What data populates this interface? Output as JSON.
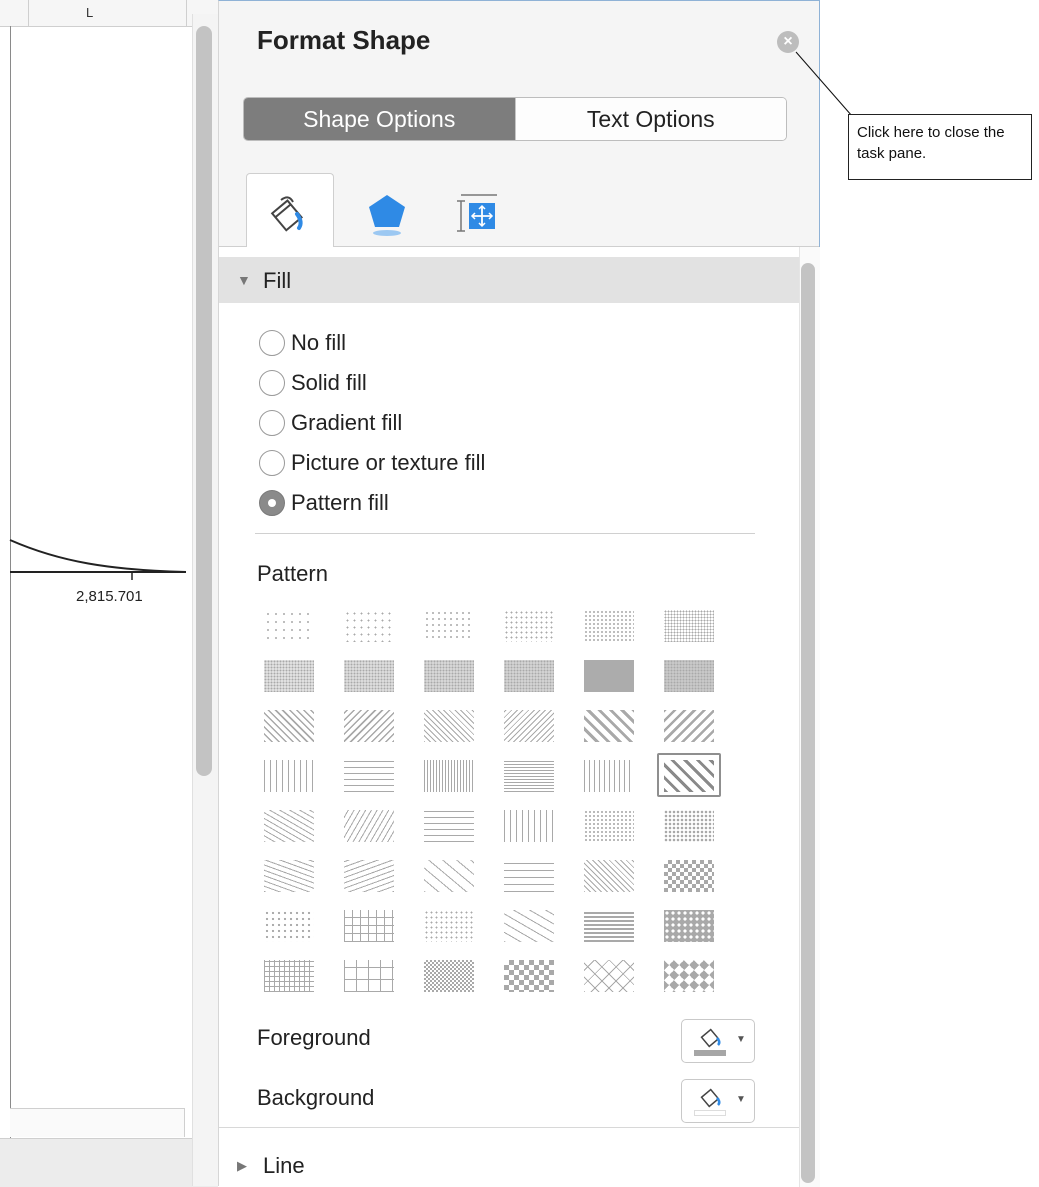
{
  "spreadsheet": {
    "column_letter": "L",
    "axis_value": "2,815.701"
  },
  "pane": {
    "title": "Format Shape",
    "close_icon": "close-icon",
    "tabs": {
      "shape_options": "Shape Options",
      "text_options": "Text Options"
    },
    "icon_tabs": [
      "fill-line-icon",
      "effects-pentagon-icon",
      "size-properties-icon"
    ],
    "fill_section": {
      "label": "Fill",
      "options": [
        {
          "label": "No fill",
          "checked": false
        },
        {
          "label": "Solid fill",
          "checked": false
        },
        {
          "label": "Gradient fill",
          "checked": false
        },
        {
          "label": "Picture or texture fill",
          "checked": false
        },
        {
          "label": "Pattern fill",
          "checked": true
        }
      ],
      "pattern_label": "Pattern",
      "pattern_rows": 8,
      "pattern_cols": 6,
      "selected_pattern": {
        "row": 3,
        "col": 5
      },
      "foreground_label": "Foreground",
      "background_label": "Background",
      "foreground_color": "#a6a6a6",
      "background_color": "#ffffff"
    },
    "line_section": {
      "label": "Line"
    }
  },
  "callout": {
    "text": "Click here to close the task pane."
  },
  "colors": {
    "active_tab": "#7d7d7d",
    "pattern_ink": "#a9a9a9",
    "accent_blue": "#2f8ae5"
  }
}
